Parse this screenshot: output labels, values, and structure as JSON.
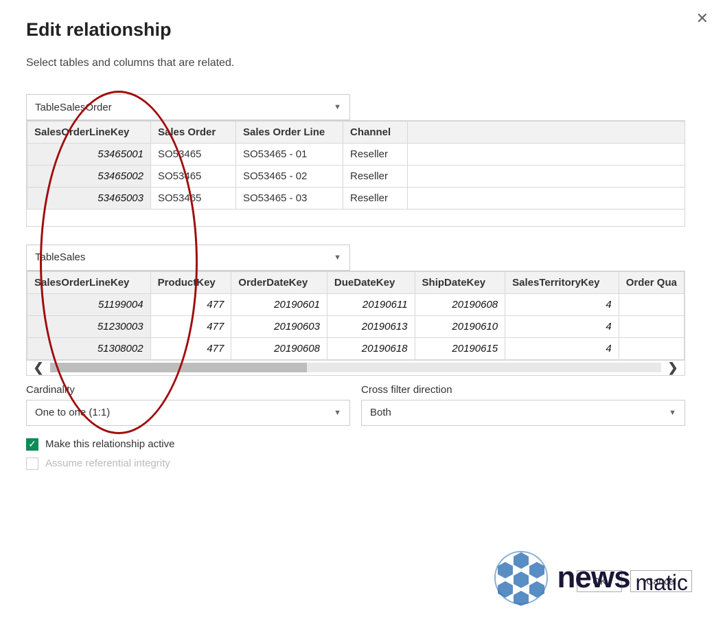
{
  "dialog": {
    "title": "Edit relationship",
    "description": "Select tables and columns that are related."
  },
  "table1": {
    "name": "TableSalesOrder",
    "headers": [
      "SalesOrderLineKey",
      "Sales Order",
      "Sales Order Line",
      "Channel"
    ],
    "rows": [
      {
        "key": "53465001",
        "order": "SO53465",
        "line": "SO53465 - 01",
        "channel": "Reseller"
      },
      {
        "key": "53465002",
        "order": "SO53465",
        "line": "SO53465 - 02",
        "channel": "Reseller"
      },
      {
        "key": "53465003",
        "order": "SO53465",
        "line": "SO53465 - 03",
        "channel": "Reseller"
      }
    ]
  },
  "table2": {
    "name": "TableSales",
    "headers": [
      "SalesOrderLineKey",
      "ProductKey",
      "OrderDateKey",
      "DueDateKey",
      "ShipDateKey",
      "SalesTerritoryKey",
      "Order Qua"
    ],
    "rows": [
      {
        "c0": "51199004",
        "c1": "477",
        "c2": "20190601",
        "c3": "20190611",
        "c4": "20190608",
        "c5": "4"
      },
      {
        "c0": "51230003",
        "c1": "477",
        "c2": "20190603",
        "c3": "20190613",
        "c4": "20190610",
        "c5": "4"
      },
      {
        "c0": "51308002",
        "c1": "477",
        "c2": "20190608",
        "c3": "20190618",
        "c4": "20190615",
        "c5": "4"
      }
    ]
  },
  "cardinality": {
    "label": "Cardinality",
    "value": "One to one (1:1)"
  },
  "crossfilter": {
    "label": "Cross filter direction",
    "value": "Both"
  },
  "checks": {
    "active": "Make this relationship active",
    "referential": "Assume referential integrity"
  },
  "buttons": {
    "ok": "OK",
    "cancel": "Cancel"
  },
  "logo": {
    "part1": "news",
    "part2": "matic"
  }
}
